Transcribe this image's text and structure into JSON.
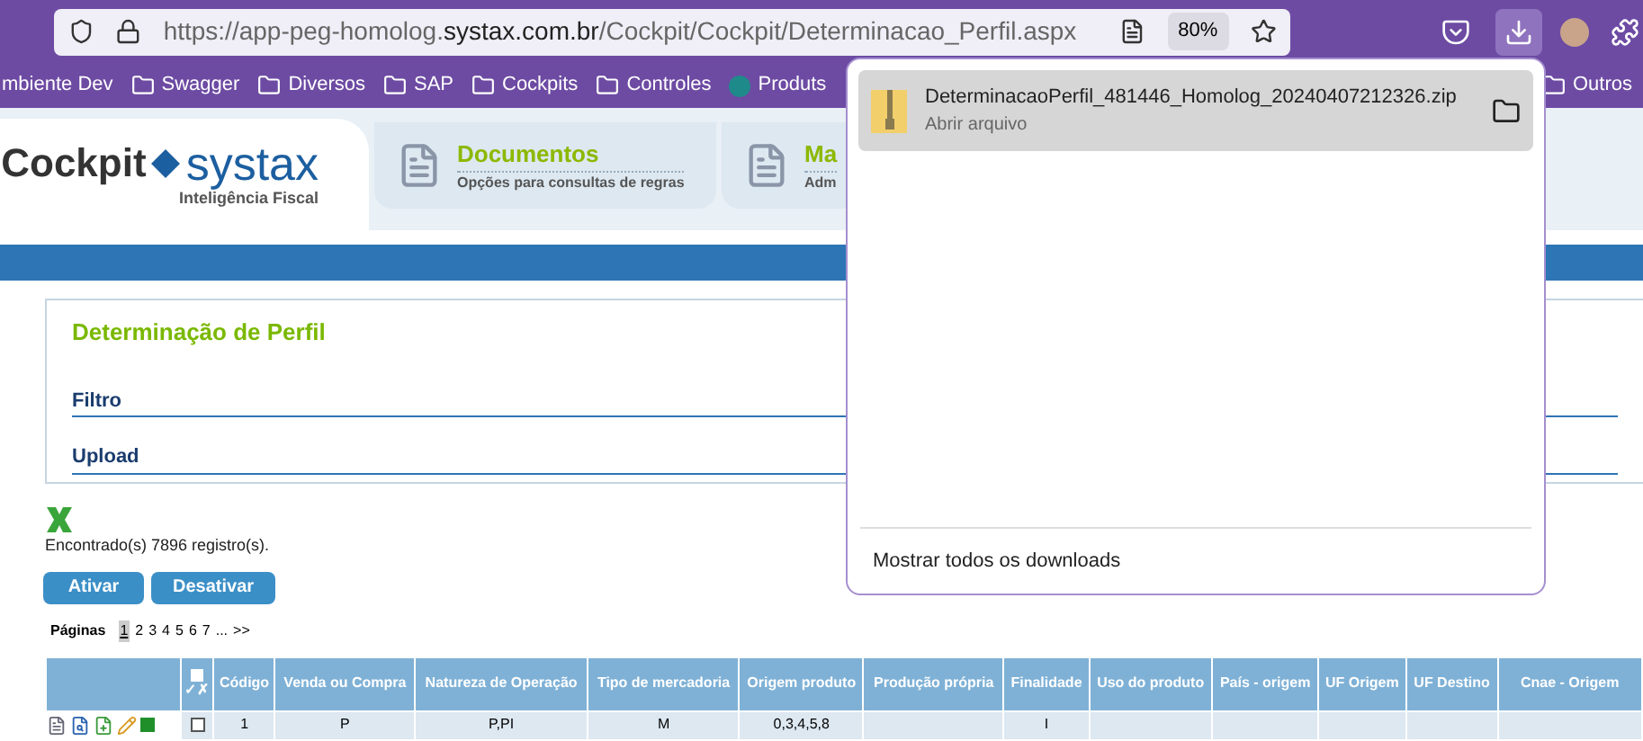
{
  "browser": {
    "url_prefix": "https://app-peg-homolog.",
    "url_domain": "systax.com.br",
    "url_path": "/Cockpit/Cockpit/Determinacao_Perfil.aspx",
    "zoom": "80%"
  },
  "bookmarks": [
    {
      "label": "mbiente Dev",
      "kind": "folder"
    },
    {
      "label": "Swagger",
      "kind": "folder"
    },
    {
      "label": "Diversos",
      "kind": "folder"
    },
    {
      "label": "SAP",
      "kind": "folder"
    },
    {
      "label": "Cockpits",
      "kind": "folder"
    },
    {
      "label": "Controles",
      "kind": "folder"
    },
    {
      "label": "Produts",
      "kind": "site"
    }
  ],
  "other_bookmarks": "Outros",
  "downloads": {
    "items": [
      {
        "filename": "DeterminacaoPerfil_481446_Homolog_20240407212326.zip",
        "action": "Abrir arquivo"
      }
    ],
    "show_all": "Mostrar todos os downloads"
  },
  "header": {
    "logo_left": "Cockpit",
    "logo_right": "systax",
    "tagline": "Inteligência Fiscal",
    "tabs": [
      {
        "title": "Documentos",
        "subtitle": "Opções para consultas de regras"
      },
      {
        "title": "Ma",
        "subtitle": "Adm"
      }
    ]
  },
  "panel": {
    "title": "Determinação de Perfil",
    "sections": [
      "Filtro",
      "Upload"
    ]
  },
  "results": "Encontrado(s) 7896 registro(s).",
  "buttons": [
    "Ativar",
    "Desativar"
  ],
  "pagination": {
    "label": "Páginas",
    "pages": [
      {
        "label": "1",
        "selected": true
      },
      {
        "label": "2",
        "selected": false
      },
      {
        "label": "3",
        "selected": false
      },
      {
        "label": "4",
        "selected": false
      },
      {
        "label": "5",
        "selected": false
      },
      {
        "label": "6",
        "selected": false
      },
      {
        "label": "7",
        "selected": false
      }
    ],
    "more": "...",
    "next": ">>"
  },
  "table": {
    "check_header": "✓✗",
    "columns": [
      "Código",
      "Venda ou Compra",
      "Natureza de Operação",
      "Tipo de mercadoria",
      "Origem produto",
      "Produção própria",
      "Finalidade",
      "Uso do produto",
      "País - origem",
      "UF Origem",
      "UF Destino",
      "Cnae - Origem"
    ],
    "rows": [
      {
        "checked": false,
        "cells": [
          "1",
          "P",
          "P,PI",
          "M",
          "0,3,4,5,8",
          "",
          "I",
          "",
          "",
          "",
          "",
          ""
        ]
      }
    ]
  }
}
